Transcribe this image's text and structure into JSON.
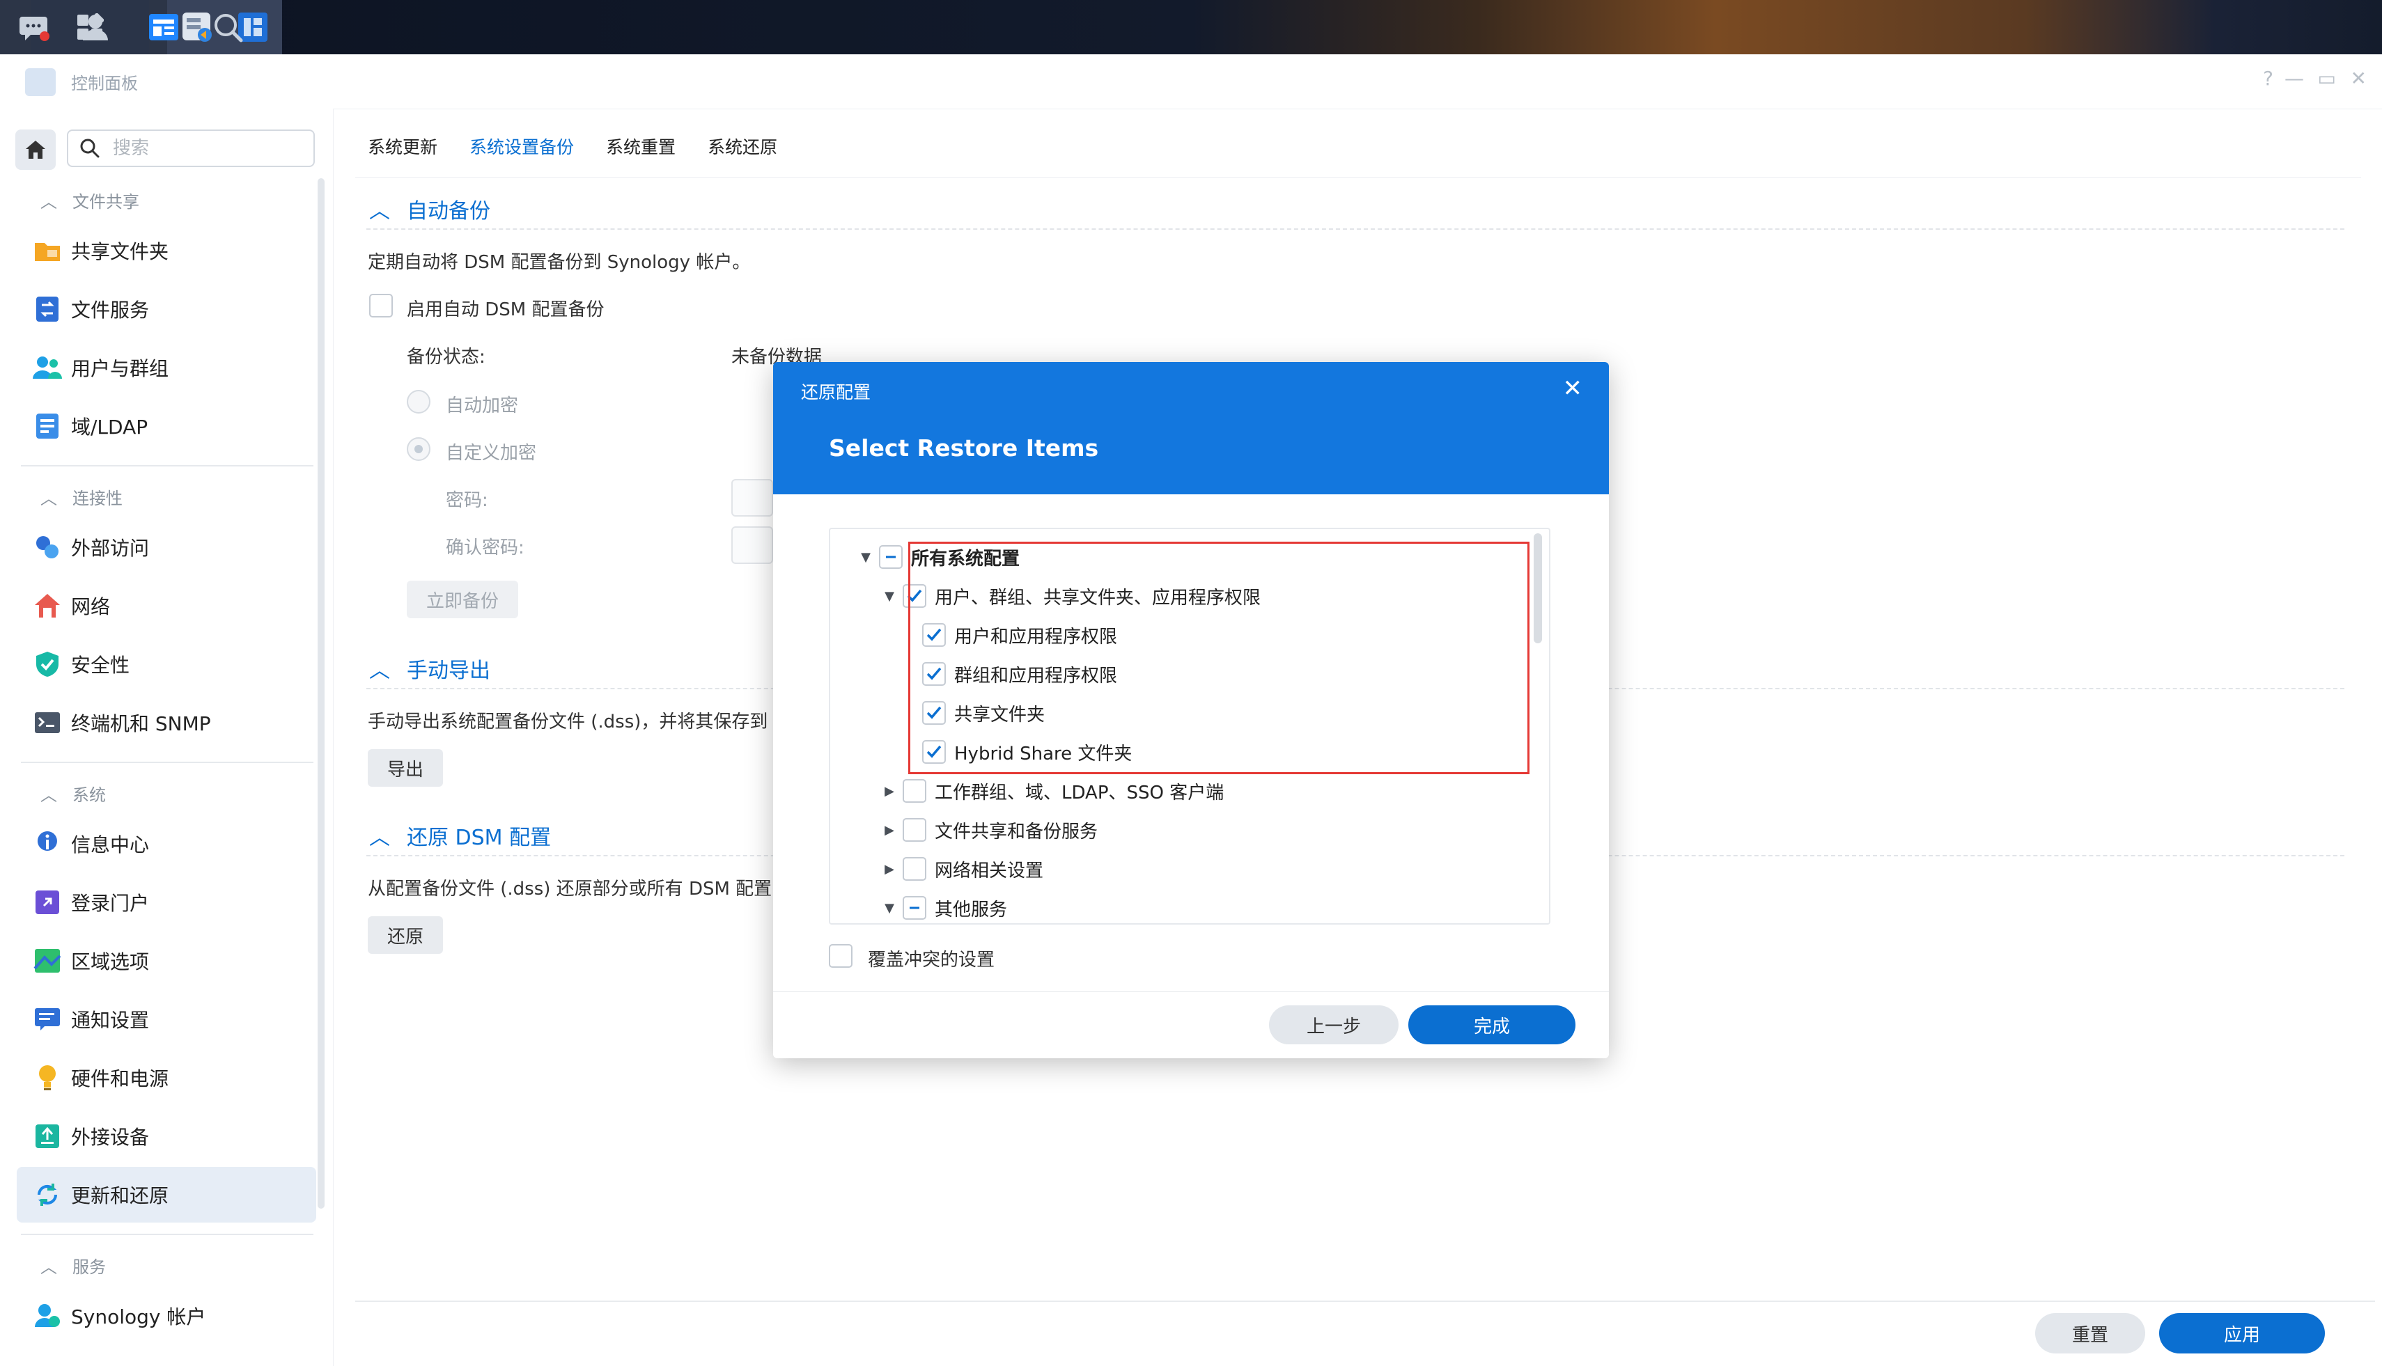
{
  "window": {
    "title": "控制面板"
  },
  "search": {
    "placeholder": "搜索"
  },
  "sidebar": {
    "sections": [
      {
        "label": "文件共享",
        "items": [
          "共享文件夹",
          "文件服务",
          "用户与群组",
          "域/LDAP"
        ]
      },
      {
        "label": "连接性",
        "items": [
          "外部访问",
          "网络",
          "安全性",
          "终端机和 SNMP"
        ]
      },
      {
        "label": "系统",
        "items": [
          "信息中心",
          "登录门户",
          "区域选项",
          "通知设置",
          "硬件和电源",
          "外接设备",
          "更新和还原"
        ]
      },
      {
        "label": "服务",
        "items": [
          "Synology 帐户"
        ]
      }
    ],
    "active_item": "更新和还原"
  },
  "tabs": [
    "系统更新",
    "系统设置备份",
    "系统重置",
    "系统还原"
  ],
  "active_tab": "系统设置备份",
  "auto_backup": {
    "title": "自动备份",
    "desc": "定期自动将 DSM 配置备份到 Synology 帐户。",
    "enable_label": "启用自动 DSM 配置备份",
    "status_label": "备份状态:",
    "status_value": "未备份数据",
    "radio_auto": "自动加密",
    "radio_custom": "自定义加密",
    "password_label": "密码:",
    "confirm_label": "确认密码:",
    "backup_now": "立即备份"
  },
  "manual_export": {
    "title": "手动导出",
    "desc": "手动导出系统配置备份文件 (.dss)，并将其保存到",
    "button": "导出"
  },
  "restore": {
    "title": "还原 DSM 配置",
    "desc": "从配置备份文件 (.dss) 还原部分或所有 DSM 配置",
    "button": "还原"
  },
  "footer": {
    "reset": "重置",
    "apply": "应用"
  },
  "modal": {
    "header": "还原配置",
    "title": "Select Restore Items",
    "tree": [
      {
        "label": "所有系统配置",
        "level": 0,
        "state": "partial",
        "expanded": true,
        "bold": true
      },
      {
        "label": "用户、群组、共享文件夹、应用程序权限",
        "level": 1,
        "state": "checked",
        "expanded": true
      },
      {
        "label": "用户和应用程序权限",
        "level": 2,
        "state": "checked"
      },
      {
        "label": "群组和应用程序权限",
        "level": 2,
        "state": "checked"
      },
      {
        "label": "共享文件夹",
        "level": 2,
        "state": "checked"
      },
      {
        "label": "Hybrid Share 文件夹",
        "level": 2,
        "state": "checked"
      },
      {
        "label": "工作群组、域、LDAP、SSO 客户端",
        "level": 1,
        "state": "unchecked",
        "expanded": false
      },
      {
        "label": "文件共享和备份服务",
        "level": 1,
        "state": "unchecked",
        "expanded": false
      },
      {
        "label": "网络相关设置",
        "level": 1,
        "state": "unchecked",
        "expanded": false
      },
      {
        "label": "其他服务",
        "level": 1,
        "state": "partial",
        "expanded": true
      }
    ],
    "overwrite_label": "覆盖冲突的设置",
    "prev": "上一步",
    "finish": "完成"
  },
  "colors": {
    "accent": "#0b6fd1",
    "modal_header": "#1377de",
    "highlight_box": "#e53935"
  }
}
